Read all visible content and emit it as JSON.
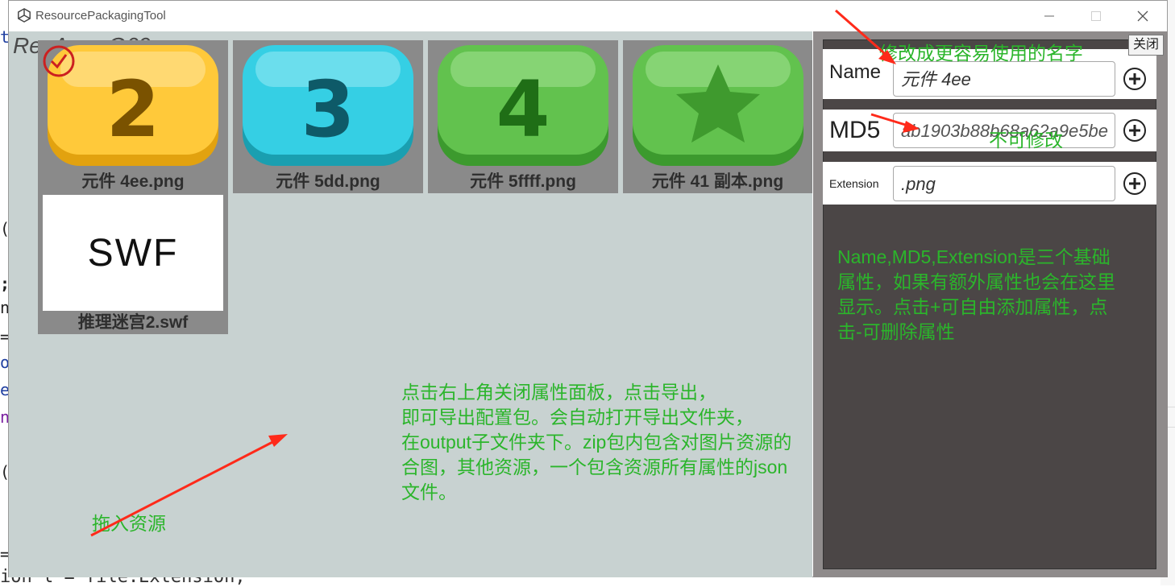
{
  "window": {
    "title": "ResourcePackagingTool"
  },
  "resource_area": {
    "title": "ResArea-G69",
    "items": [
      {
        "label": "元件 4ee.png",
        "icon": "number-2-button-icon",
        "color": "#f2b71a"
      },
      {
        "label": "元件 5dd.png",
        "icon": "number-3-button-icon",
        "color": "#2fc4d8"
      },
      {
        "label": "元件 5ffff.png",
        "icon": "number-4-button-icon",
        "color": "#5cbf4a"
      },
      {
        "label": "元件 41 副本.png",
        "icon": "star-button-icon",
        "color": "#5cbf4a"
      },
      {
        "label": "推理迷宫2.swf",
        "icon": "swf-file-icon",
        "preview_text": "SWF"
      }
    ]
  },
  "panel": {
    "close_label": "关闭",
    "properties": [
      {
        "label": "Name",
        "value": "元件 4ee"
      },
      {
        "label": "MD5",
        "value": "ab1903b88b68a62a9e5be"
      },
      {
        "label": "Extension",
        "value": ".png"
      }
    ]
  },
  "annotations": {
    "rename": "修改成更容易使用的名字",
    "readonly": "不可修改",
    "props_info": "Name,MD5,Extension是三个基础\n属性，如果有额外属性也会在这里\n显示。点击+可自由添加属性，点\n击-可删除属性",
    "export_info": "点击右上角关闭属性面板，点击导出，\n即可导出配置包。会自动打开导出文件夹，\n在output子文件夹下。zip包内包含对图片资源的\n合图，其他资源，一个包含资源所有属性的json\n文件。",
    "drag_in": "拖入资源"
  },
  "background_code": {
    "bottom_line": "ion l = file.Extension;"
  },
  "colors": {
    "annotation": "#2bb52b",
    "arrow": "#ff2a1a",
    "panel_bg": "#4b4646",
    "area_bg": "#c8d2d1"
  }
}
